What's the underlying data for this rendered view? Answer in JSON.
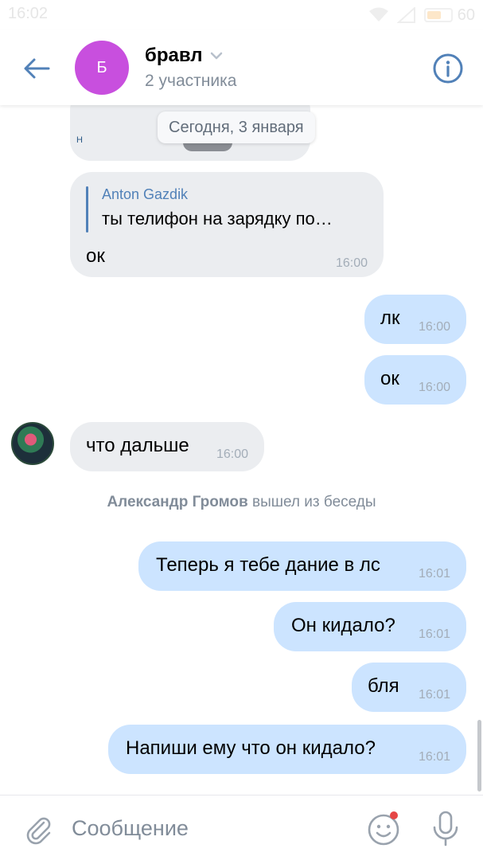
{
  "status_bar": {
    "time": "16:02",
    "battery": "60",
    "battery_level": 0.6
  },
  "header": {
    "avatar_letter": "Б",
    "title": "бравл",
    "subtitle": "2 участника",
    "accent": "#5181b8",
    "avatar_color": "#c84fde"
  },
  "chat": {
    "date_divider": "Сегодня, 3 января",
    "messages": [
      {
        "direction": "in",
        "reply_author": "Anton Gazdik",
        "reply_quote": "ты телифон на зарядку по…",
        "text": "ок",
        "time": "16:00"
      },
      {
        "direction": "out",
        "text": "лк",
        "time": "16:00"
      },
      {
        "direction": "out",
        "text": "ок",
        "time": "16:00"
      },
      {
        "direction": "in",
        "text": "что дальше",
        "time": "16:00"
      },
      {
        "direction": "out",
        "text": "Теперь я тебе дание в лс",
        "time": "16:01"
      },
      {
        "direction": "out",
        "text": "Он кидало?",
        "time": "16:01"
      },
      {
        "direction": "out",
        "text": "бля",
        "time": "16:01"
      },
      {
        "direction": "out",
        "text": "Напиши ему что он кидало?",
        "time": "16:01"
      }
    ],
    "service": {
      "name": "Александр Громов",
      "action": "вышел из беседы"
    },
    "colors": {
      "incoming_bubble": "#ebedf0",
      "outgoing_bubble": "#cce4ff",
      "time": "#a3adb8"
    }
  },
  "composer": {
    "placeholder": "Сообщение",
    "value": "",
    "icons": [
      "paperclip-icon",
      "emoji-icon",
      "microphone-icon"
    ]
  }
}
